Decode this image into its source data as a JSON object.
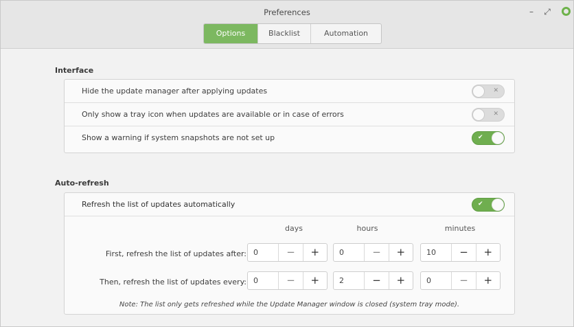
{
  "window": {
    "title": "Preferences"
  },
  "tabs": [
    {
      "label": "Options",
      "active": true
    },
    {
      "label": "Blacklist",
      "active": false
    },
    {
      "label": "Automation",
      "active": false
    }
  ],
  "interface": {
    "title": "Interface",
    "rows": [
      {
        "label": "Hide the update manager after applying updates",
        "enabled": false
      },
      {
        "label": "Only show a tray icon when updates are available or in case of errors",
        "enabled": false
      },
      {
        "label": "Show a warning if system snapshots are not set up",
        "enabled": true
      }
    ]
  },
  "autorefresh": {
    "title": "Auto-refresh",
    "toggle_label": "Refresh the list of updates automatically",
    "enabled": true,
    "columns": [
      "days",
      "hours",
      "minutes"
    ],
    "first": {
      "label": "First, refresh the list of updates after:",
      "days": "0",
      "hours": "0",
      "minutes": "10"
    },
    "then": {
      "label": "Then, refresh the list of updates every:",
      "days": "0",
      "hours": "2",
      "minutes": "0"
    },
    "note": "Note: The list only gets refreshed while the Update Manager window is closed (system tray mode)."
  },
  "icons": {
    "minimize": "minimize-icon",
    "maximize": "maximize-icon",
    "close": "close-icon",
    "toggle_on": "checkmark-icon",
    "toggle_off": "cross-icon"
  },
  "colors": {
    "accent": "#7cb860",
    "switch_on": "#6fae4f"
  }
}
